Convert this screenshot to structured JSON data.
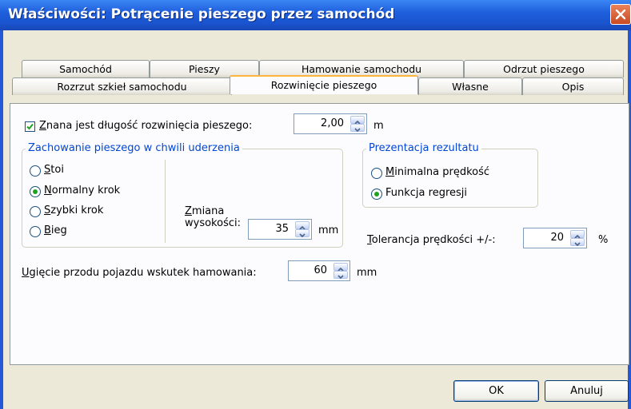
{
  "window": {
    "title": "Właściwości: Potrącenie pieszego przez samochód"
  },
  "tabs": {
    "row1": [
      "Samochód",
      "Pieszy",
      "Hamowanie samochodu",
      "Odrzut pieszego"
    ],
    "row2": [
      "Rozrzut szkieł samochodu",
      "Rozwinięcie pieszego",
      "Własne",
      "Opis"
    ],
    "active": "Rozwinięcie pieszego"
  },
  "known_length": {
    "checked": true,
    "label_underlined": "Z",
    "label_rest": "nana jest długość rozwinięcia pieszego:",
    "value": "2,00",
    "unit": "m"
  },
  "behavior_group": {
    "legend": "Zachowanie pieszego w chwili uderzenia",
    "options": [
      {
        "u": "S",
        "rest": "toi",
        "selected": false
      },
      {
        "u": "N",
        "rest": "ormalny krok",
        "selected": true
      },
      {
        "u": "S",
        "rest": "zybki krok",
        "selected": false
      },
      {
        "u": "B",
        "rest": "ieg",
        "selected": false
      }
    ],
    "height_change_label_u": "Z",
    "height_change_label_line1_rest": "miana",
    "height_change_label_line2": "wysokości:",
    "height_change_value": "35",
    "height_change_unit": "mm"
  },
  "presentation_group": {
    "legend": "Prezentacja rezultatu",
    "options": [
      {
        "u": "M",
        "rest": "inimalna prędkość",
        "selected": false
      },
      {
        "u": "",
        "rest": "Funkcja regresji",
        "selected": true
      }
    ]
  },
  "speed_tolerance": {
    "label_u": "T",
    "label_rest": "olerancja prędkości +/-:",
    "value": "20",
    "unit": "%"
  },
  "deflection": {
    "label_u": "U",
    "label_rest": "gięcie przodu pojazdu wskutek hamowania:",
    "value": "60",
    "unit": "mm"
  },
  "buttons": {
    "ok": "OK",
    "cancel": "Anuluj"
  },
  "colors": {
    "title_bar": "#1f5fdc",
    "dialog_bg": "#ece9d8",
    "group_legend": "#0046d5",
    "active_tab_accent": "#ffb53c",
    "radio_selected": "#21a121",
    "close_button": "#c94a22"
  }
}
